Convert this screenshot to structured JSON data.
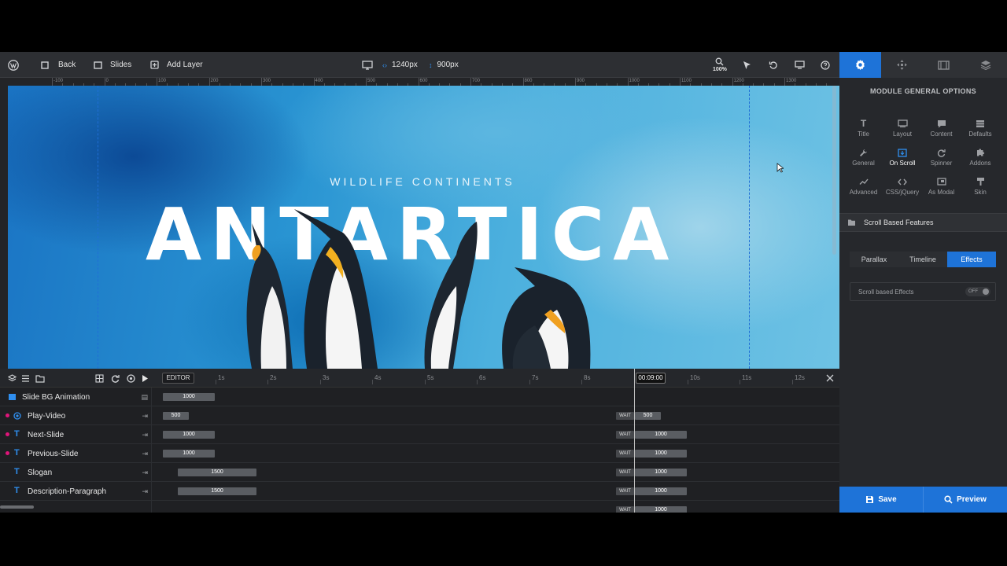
{
  "toolbar": {
    "back_label": "Back",
    "slides_label": "Slides",
    "add_layer_label": "Add Layer",
    "width_value": "1240px",
    "height_value": "900px",
    "zoom_label": "100%"
  },
  "ruler": {
    "labels": [
      "-100",
      "0",
      "100",
      "200",
      "300",
      "400",
      "500",
      "600",
      "700",
      "800",
      "900",
      "1000",
      "1100",
      "1200",
      "1300"
    ]
  },
  "slide": {
    "slogan": "WILDLIFE CONTINENTS",
    "title": "ANTARTICA"
  },
  "timeline": {
    "editor_label": "EDITOR",
    "current_time": "00:09:00",
    "time_labels": [
      "1s",
      "2s",
      "3s",
      "4s",
      "5s",
      "6s",
      "7s",
      "8s",
      "10s",
      "11s",
      "12s"
    ],
    "wait_label": "WAIT",
    "layers": [
      {
        "name": "Slide BG Animation",
        "bar": "1000",
        "end": ""
      },
      {
        "name": "Play-Video",
        "bar": "500",
        "end": "500"
      },
      {
        "name": "Next-Slide",
        "bar": "1000",
        "end": "1000"
      },
      {
        "name": "Previous-Slide",
        "bar": "1000",
        "end": "1000"
      },
      {
        "name": "Slogan",
        "bar": "1500",
        "end": "1000"
      },
      {
        "name": "Description-Paragraph",
        "bar": "1500",
        "end": "1000"
      },
      {
        "name": "",
        "bar": "",
        "end": "1000"
      }
    ]
  },
  "panel": {
    "title": "MODULE GENERAL OPTIONS",
    "options": [
      {
        "label": "Title",
        "icon": "title-icon"
      },
      {
        "label": "Layout",
        "icon": "layout-icon"
      },
      {
        "label": "Content",
        "icon": "content-icon"
      },
      {
        "label": "Defaults",
        "icon": "defaults-icon"
      },
      {
        "label": "General",
        "icon": "wrench-icon"
      },
      {
        "label": "On Scroll",
        "icon": "scroll-icon"
      },
      {
        "label": "Spinner",
        "icon": "spinner-icon"
      },
      {
        "label": "Addons",
        "icon": "puzzle-icon"
      },
      {
        "label": "Advanced",
        "icon": "chart-icon"
      },
      {
        "label": "CSS/jQuery",
        "icon": "code-icon"
      },
      {
        "label": "As Modal",
        "icon": "modal-icon"
      },
      {
        "label": "Skin",
        "icon": "brush-icon"
      }
    ],
    "section_title": "Scroll Based Features",
    "subtabs": [
      "Parallax",
      "Timeline",
      "Effects"
    ],
    "scroll_effects_label": "Scroll based Effects",
    "scroll_effects_state": "OFF",
    "save_label": "Save",
    "preview_label": "Preview"
  },
  "colors": {
    "accent": "#1e73d8",
    "layer_dot": "#e0157a",
    "layer_icon": "#2f8ff0"
  }
}
